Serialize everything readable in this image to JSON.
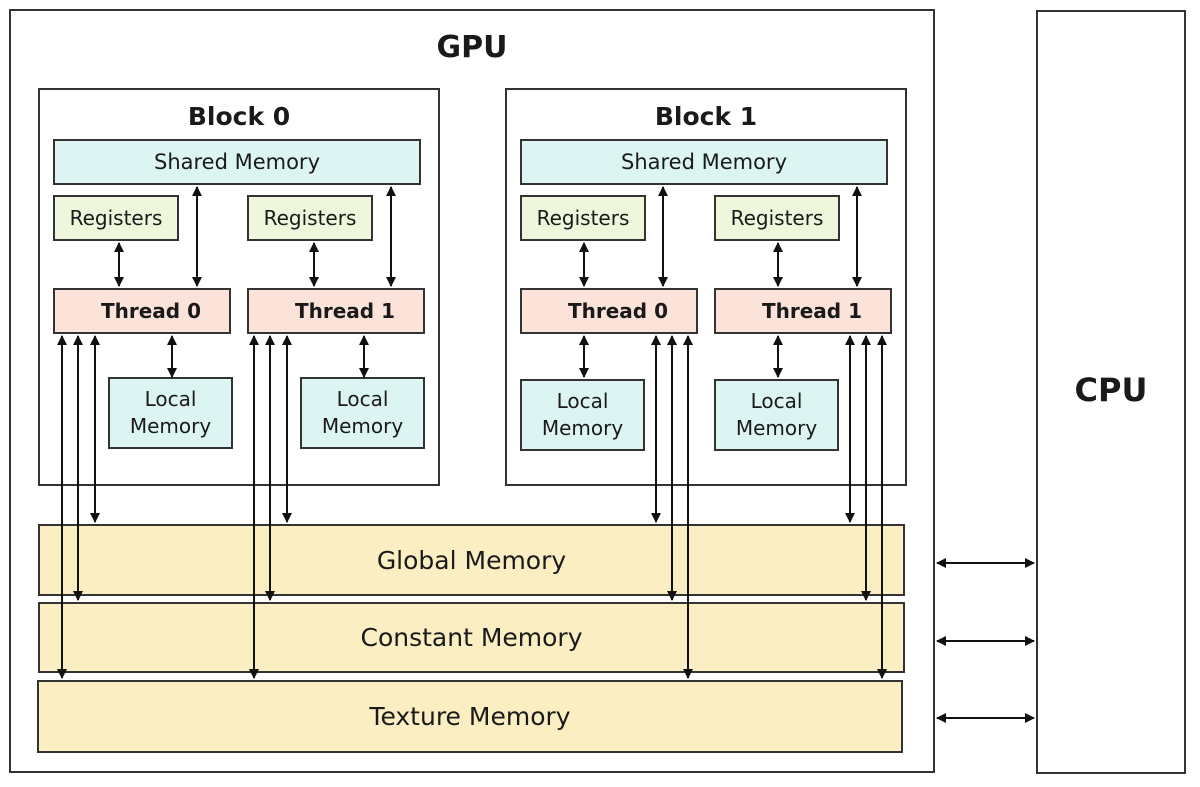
{
  "diagram": {
    "gpu_label": "GPU",
    "cpu_label": "CPU",
    "blocks": [
      {
        "title": "Block 0",
        "shared_memory": "Shared Memory",
        "threads": [
          {
            "name": "Thread 0",
            "registers": "Registers",
            "local_line1": "Local",
            "local_line2": "Memory"
          },
          {
            "name": "Thread 1",
            "registers": "Registers",
            "local_line1": "Local",
            "local_line2": "Memory"
          }
        ]
      },
      {
        "title": "Block 1",
        "shared_memory": "Shared Memory",
        "threads": [
          {
            "name": "Thread 0",
            "registers": "Registers",
            "local_line1": "Local",
            "local_line2": "Memory"
          },
          {
            "name": "Thread 1",
            "registers": "Registers",
            "local_line1": "Local",
            "local_line2": "Memory"
          }
        ]
      }
    ],
    "global_memory": "Global Memory",
    "constant_memory": "Constant Memory",
    "texture_memory": "Texture Memory"
  }
}
